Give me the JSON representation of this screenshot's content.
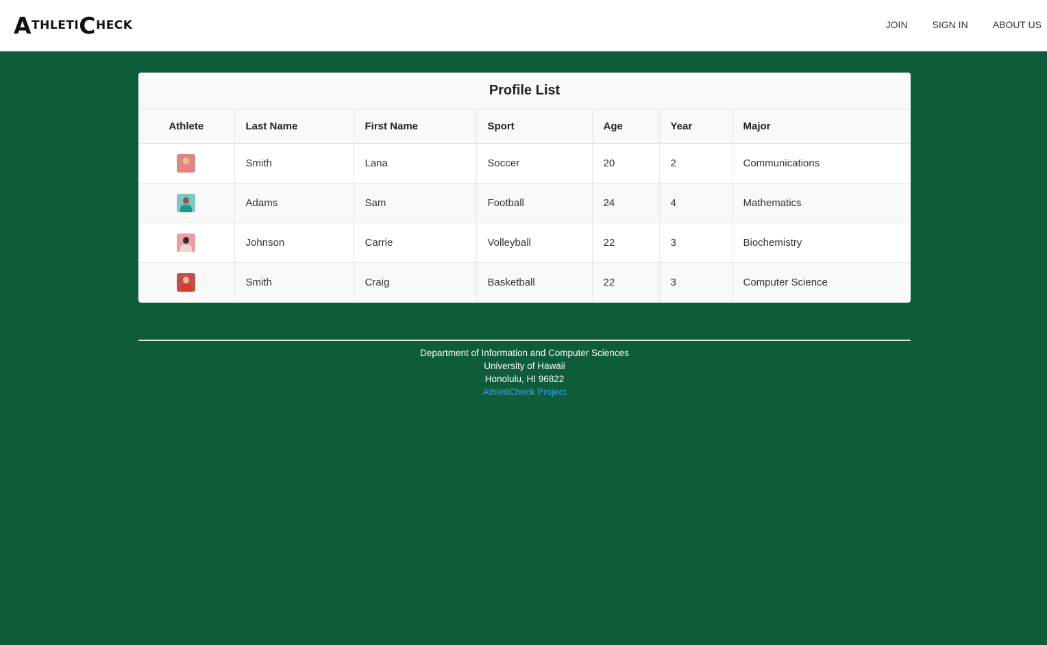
{
  "header": {
    "logo_first": "A",
    "logo_mid": "THLETI",
    "logo_second": "C",
    "logo_end": "HECK",
    "nav": [
      "JOIN",
      "SIGN IN",
      "ABOUT US"
    ]
  },
  "profile_list": {
    "title": "Profile List",
    "columns": [
      "Athlete",
      "Last Name",
      "First Name",
      "Sport",
      "Age",
      "Year",
      "Major"
    ],
    "rows": [
      {
        "avatar": "female-athlete-avatar",
        "last": "Smith",
        "first": "Lana",
        "sport": "Soccer",
        "age": "20",
        "year": "2",
        "major": "Communications"
      },
      {
        "avatar": "male-athlete-avatar",
        "last": "Adams",
        "first": "Sam",
        "sport": "Football",
        "age": "24",
        "year": "4",
        "major": "Mathematics"
      },
      {
        "avatar": "female-athlete-avatar",
        "last": "Johnson",
        "first": "Carrie",
        "sport": "Volleyball",
        "age": "22",
        "year": "3",
        "major": "Biochemistry"
      },
      {
        "avatar": "male-athlete-avatar",
        "last": "Smith",
        "first": "Craig",
        "sport": "Basketball",
        "age": "22",
        "year": "3",
        "major": "Computer Science"
      }
    ]
  },
  "footer": {
    "line1": "Department of Information and Computer Sciences",
    "line2": "University of Hawaii",
    "line3": "Honolulu, HI 96822",
    "link": "AthletiCheck Project"
  },
  "colors": {
    "background": "#0f5c3b",
    "link": "#3ba0e0"
  }
}
